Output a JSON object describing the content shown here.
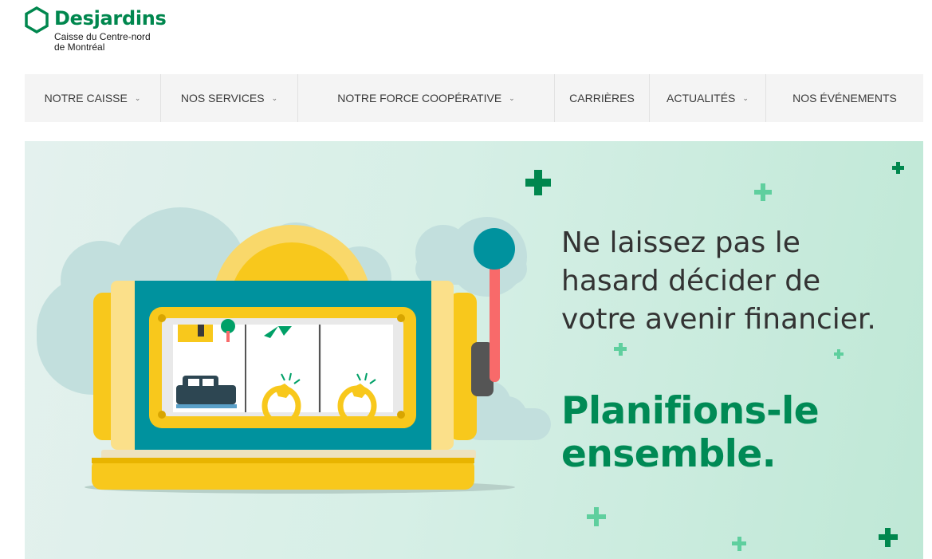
{
  "brand": {
    "name": "Desjardins",
    "subtitle_line1": "Caisse du Centre-nord",
    "subtitle_line2": "de Montréal",
    "color": "#00874e"
  },
  "nav": {
    "items": [
      {
        "label": "NOTRE CAISSE",
        "dropdown": true
      },
      {
        "label": "NOS SERVICES",
        "dropdown": true
      },
      {
        "label": "NOTRE FORCE COOPÉRATIVE",
        "dropdown": true
      },
      {
        "label": "CARRIÈRES",
        "dropdown": false
      },
      {
        "label": "ACTUALITÉS",
        "dropdown": true
      },
      {
        "label": "NOS ÉVÉNEMENTS",
        "dropdown": false
      }
    ],
    "chevron": "⌄"
  },
  "hero": {
    "headline_line1": "Ne laissez pas le",
    "headline_line2": "hasard décider de",
    "headline_line3": "votre avenir financier.",
    "tagline_line1": "Planifions-le",
    "tagline_line2": "ensemble.",
    "tagline_color": "#008a55",
    "illustration": "slot-machine-illustration"
  }
}
